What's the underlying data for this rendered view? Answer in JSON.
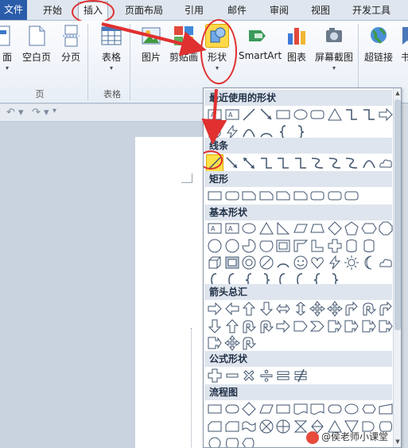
{
  "tabs": [
    "文件",
    "开始",
    "插入",
    "页面布局",
    "引用",
    "邮件",
    "审阅",
    "视图",
    "开发工具"
  ],
  "ribbon": {
    "buttons": [
      "面",
      "空白页",
      "分页",
      "表格",
      "图片",
      "剪贴画",
      "形状",
      "SmartArt",
      "图表",
      "屏幕截图",
      "超链接",
      "书"
    ],
    "groups": [
      "页",
      "表格"
    ]
  },
  "shapes_menu": {
    "sections": [
      "最近使用的形状",
      "线条",
      "矩形",
      "基本形状",
      "箭头总汇",
      "公式形状",
      "流程图"
    ]
  },
  "watermark": "@侯老师小课堂",
  "colors": {
    "accent": "#2a5caa",
    "annotation": "#e03030",
    "highlight_fill": "#ffe14a"
  }
}
